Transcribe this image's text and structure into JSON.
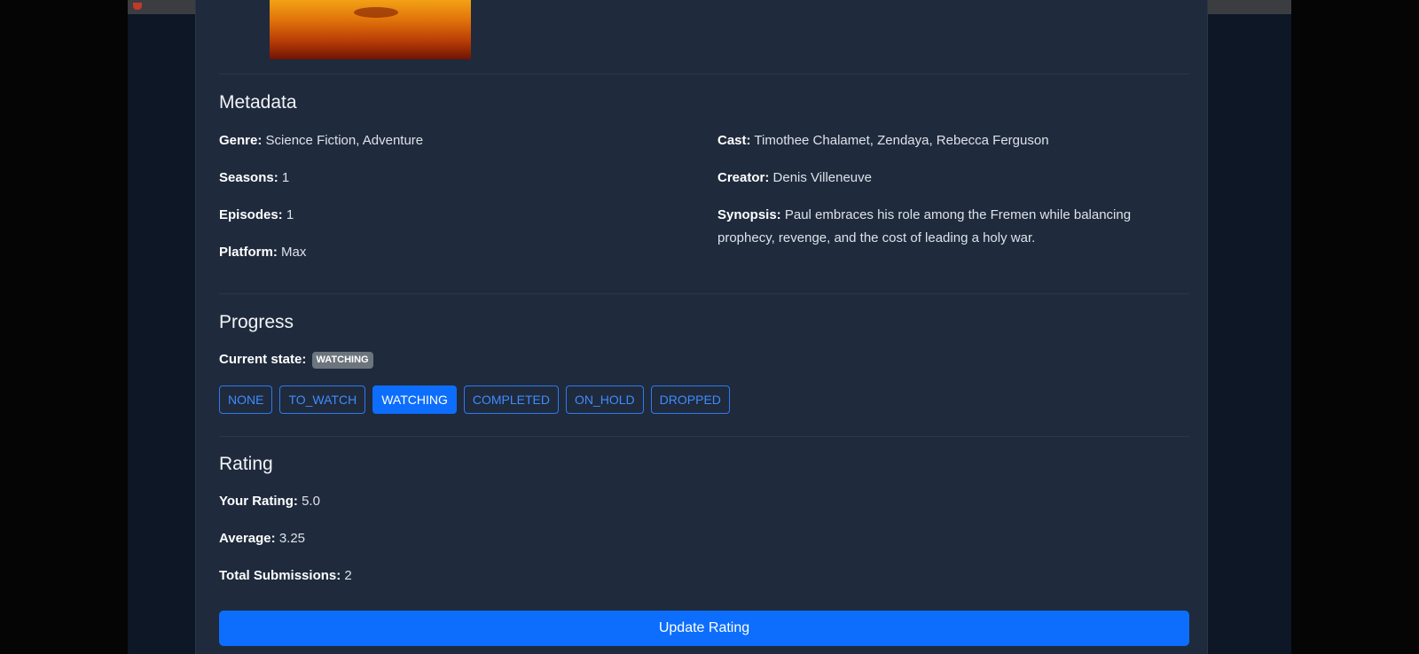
{
  "metadata": {
    "heading": "Metadata",
    "genre_label": "Genre:",
    "genre": "Science Fiction, Adventure",
    "seasons_label": "Seasons:",
    "seasons": "1",
    "episodes_label": "Episodes:",
    "episodes": "1",
    "platform_label": "Platform:",
    "platform": "Max",
    "cast_label": "Cast:",
    "cast": "Timothee Chalamet, Zendaya, Rebecca Ferguson",
    "creator_label": "Creator:",
    "creator": "Denis Villeneuve",
    "synopsis_label": "Synopsis:",
    "synopsis_line1": "Paul embraces his role among the Fremen while balancing",
    "synopsis_line2": "prophecy, revenge, and the cost of leading a holy war."
  },
  "progress": {
    "heading": "Progress",
    "current_state_label": "Current state:",
    "current_state": "WATCHING",
    "states": [
      {
        "label": "NONE",
        "active": false
      },
      {
        "label": "TO_WATCH",
        "active": false
      },
      {
        "label": "WATCHING",
        "active": true
      },
      {
        "label": "COMPLETED",
        "active": false
      },
      {
        "label": "ON_HOLD",
        "active": false
      },
      {
        "label": "DROPPED",
        "active": false
      }
    ]
  },
  "rating": {
    "heading": "Rating",
    "your_rating_label": "Your Rating:",
    "your_rating": "5.0",
    "average_label": "Average:",
    "average": "3.25",
    "total_label": "Total Submissions:",
    "total": "2",
    "update_button": "Update Rating"
  },
  "colors": {
    "background": "#0e1726",
    "card": "#1f2a3c",
    "accent": "#0d6efd",
    "badge": "#6c757d"
  }
}
